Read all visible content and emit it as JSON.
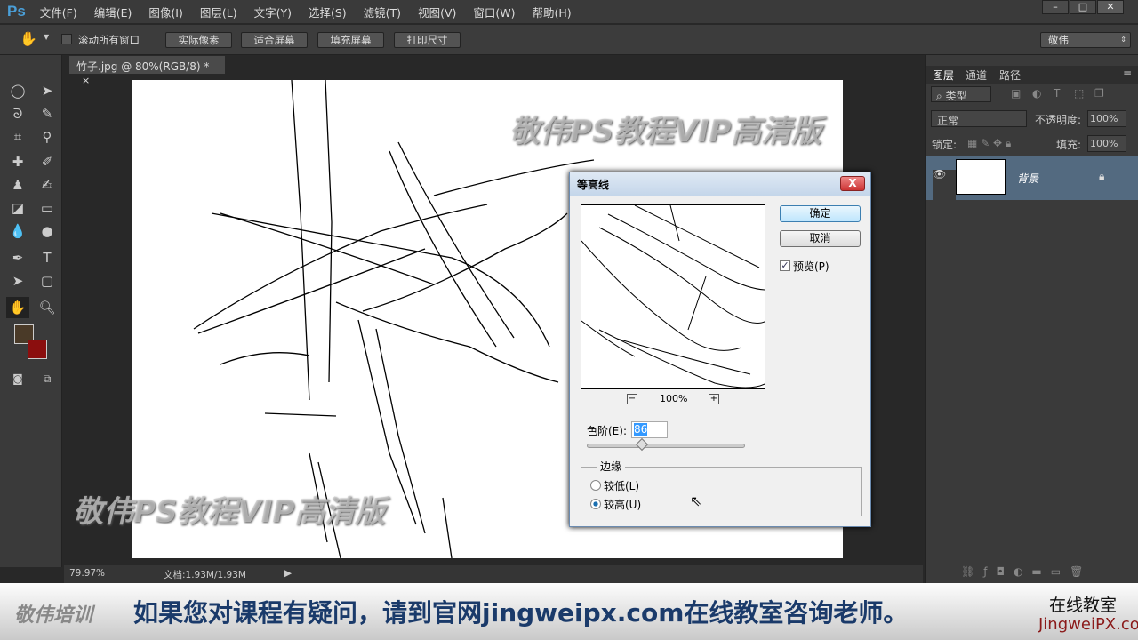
{
  "app": {
    "logo": "Ps",
    "menus": [
      "文件(F)",
      "编辑(E)",
      "图像(I)",
      "图层(L)",
      "文字(Y)",
      "选择(S)",
      "滤镜(T)",
      "视图(V)",
      "窗口(W)",
      "帮助(H)"
    ]
  },
  "options": {
    "scroll_all": "滚动所有窗口",
    "buttons": [
      "实际像素",
      "适合屏幕",
      "填充屏幕",
      "打印尺寸"
    ],
    "workspace": "敬伟"
  },
  "document": {
    "tab": "竹子.jpg @ 80%(RGB/8) *",
    "close": "×",
    "watermark": "敬伟PS教程VIP高清版"
  },
  "status": {
    "zoom": "79.97%",
    "doc": "文档:1.93M/1.93M"
  },
  "dialog": {
    "title": "等高线",
    "close": "X",
    "ok": "确定",
    "cancel": "取消",
    "preview_label": "预览(P)",
    "preview_checked": true,
    "zoom": "100%",
    "zoom_out": "−",
    "zoom_in": "+",
    "level_label": "色阶(E):",
    "level_value": "86",
    "level_fraction": 0.34,
    "edge_group": "边缘",
    "edge_low": "较低(L)",
    "edge_high": "较高(U)",
    "edge_selected": "较高(U)"
  },
  "layers": {
    "tabs": [
      "图层",
      "通道",
      "路径"
    ],
    "filter": "类型",
    "blend": "正常",
    "opacity_label": "不透明度:",
    "opacity": "100%",
    "lock_label": "锁定:",
    "fill_label": "填充:",
    "fill": "100%",
    "layer_name": "背景"
  },
  "colors": {
    "foreground": "#4a3a28",
    "background": "#8b0e0e"
  },
  "banner": {
    "brand": "敬伟培训",
    "message": "如果您对课程有疑问，请到官网jingweipx.com在线教室咨询老师。",
    "right_top": "在线教室",
    "right_bottom": "JingweiPX.com"
  }
}
